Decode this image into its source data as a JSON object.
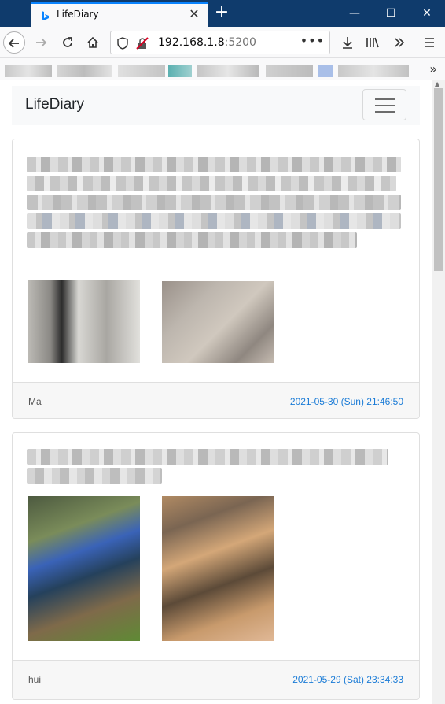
{
  "browser": {
    "tab_title": "LifeDiary",
    "tab_close": "✕",
    "new_tab": "+",
    "url_host": "192.168.1.8",
    "url_port": ":5200",
    "url_more": "•••",
    "minimize": "—",
    "maximize": "☐",
    "close": "✕",
    "bookmarks_more": "»"
  },
  "app": {
    "brand": "LifeDiary"
  },
  "posts": [
    {
      "author": "Ma",
      "date": "2021-05-30 (Sun) 21:46:50"
    },
    {
      "author": "hui",
      "date": "2021-05-29 (Sat) 23:34:33"
    }
  ],
  "colors": {
    "titlebar": "#0f3b6c",
    "accent": "#0a84ff",
    "date_link": "#1a7bd6"
  }
}
